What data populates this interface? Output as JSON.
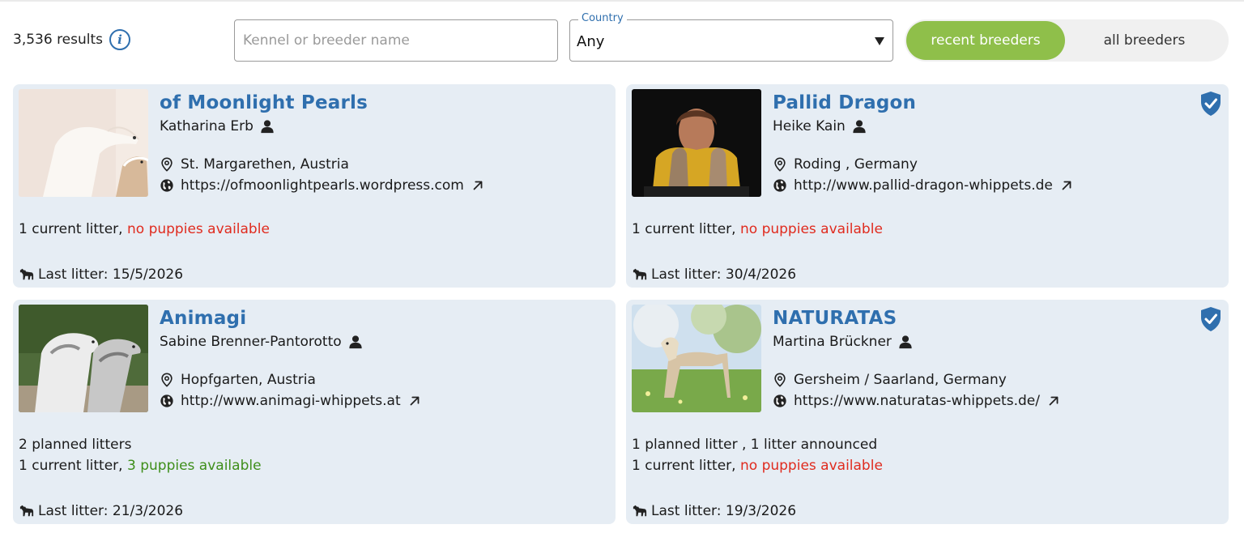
{
  "toolbar": {
    "results_text": "3,536 results",
    "search_placeholder": "Kennel or breeder name",
    "country_label": "Country",
    "country_value": "Any",
    "toggle_active": "recent breeders",
    "toggle_inactive": "all breeders"
  },
  "colors": {
    "accent_blue": "#2f6fae",
    "toggle_green": "#8fbf4a",
    "card_bg": "#e6edf4",
    "unavailable_red": "#e02b1e",
    "available_green": "#3e8e1a"
  },
  "icons": [
    "info-icon",
    "chevron-down-icon",
    "person-icon",
    "location-pin-icon",
    "globe-icon",
    "external-link-icon",
    "verified-shield-icon",
    "dog-icon"
  ],
  "cards": [
    {
      "kennel": "of Moonlight Pearls",
      "breeder": "Katharina Erb",
      "location": "St. Margarethen, Austria",
      "website": "https://ofmoonlightpearls.wordpress.com",
      "verified": false,
      "planned_line": "",
      "current_prefix": "1 current litter,",
      "current_status": "no puppies available",
      "last_litter": "Last litter: 15/5/2026"
    },
    {
      "kennel": "Pallid Dragon",
      "breeder": "Heike Kain",
      "location": "Roding , Germany",
      "website": "http://www.pallid-dragon-whippets.de",
      "verified": true,
      "planned_line": "",
      "current_prefix": "1 current litter,",
      "current_status": "no puppies available",
      "last_litter": "Last litter: 30/4/2026"
    },
    {
      "kennel": "Animagi",
      "breeder": "Sabine Brenner-Pantorotto",
      "location": "Hopfgarten, Austria",
      "website": "http://www.animagi-whippets.at",
      "verified": false,
      "planned_line": "2 planned litters",
      "current_prefix": "1 current litter,",
      "current_status": "3 puppies available",
      "last_litter": "Last litter: 21/3/2026"
    },
    {
      "kennel": "NATURATAS",
      "breeder": "Martina Brückner",
      "location": "Gersheim / Saarland, Germany",
      "website": "https://www.naturatas-whippets.de/",
      "verified": true,
      "planned_line": "1 planned litter , 1 litter announced",
      "current_prefix": "1 current litter,",
      "current_status": "no puppies available",
      "last_litter": "Last litter: 19/3/2026"
    }
  ]
}
